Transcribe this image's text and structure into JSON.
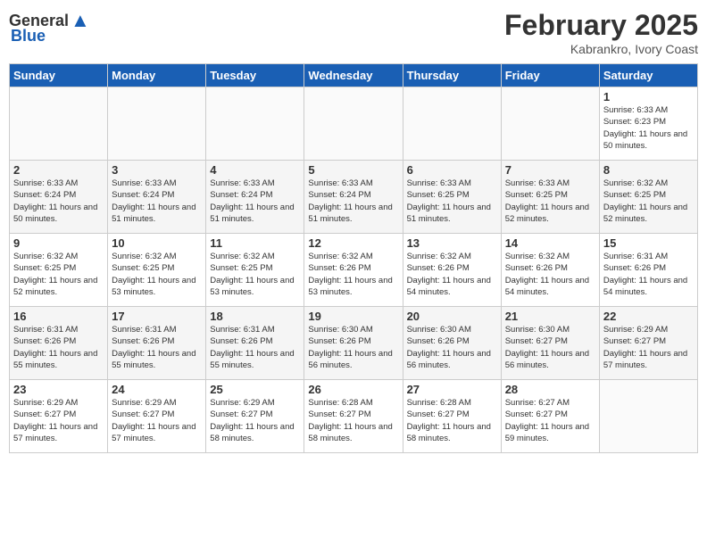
{
  "header": {
    "logo_general": "General",
    "logo_blue": "Blue",
    "main_title": "February 2025",
    "subtitle": "Kabrankro, Ivory Coast"
  },
  "days_of_week": [
    "Sunday",
    "Monday",
    "Tuesday",
    "Wednesday",
    "Thursday",
    "Friday",
    "Saturday"
  ],
  "weeks": [
    [
      {
        "day": "",
        "content": ""
      },
      {
        "day": "",
        "content": ""
      },
      {
        "day": "",
        "content": ""
      },
      {
        "day": "",
        "content": ""
      },
      {
        "day": "",
        "content": ""
      },
      {
        "day": "",
        "content": ""
      },
      {
        "day": "1",
        "content": "Sunrise: 6:33 AM\nSunset: 6:23 PM\nDaylight: 11 hours and 50 minutes."
      }
    ],
    [
      {
        "day": "2",
        "content": "Sunrise: 6:33 AM\nSunset: 6:24 PM\nDaylight: 11 hours and 50 minutes."
      },
      {
        "day": "3",
        "content": "Sunrise: 6:33 AM\nSunset: 6:24 PM\nDaylight: 11 hours and 51 minutes."
      },
      {
        "day": "4",
        "content": "Sunrise: 6:33 AM\nSunset: 6:24 PM\nDaylight: 11 hours and 51 minutes."
      },
      {
        "day": "5",
        "content": "Sunrise: 6:33 AM\nSunset: 6:24 PM\nDaylight: 11 hours and 51 minutes."
      },
      {
        "day": "6",
        "content": "Sunrise: 6:33 AM\nSunset: 6:25 PM\nDaylight: 11 hours and 51 minutes."
      },
      {
        "day": "7",
        "content": "Sunrise: 6:33 AM\nSunset: 6:25 PM\nDaylight: 11 hours and 52 minutes."
      },
      {
        "day": "8",
        "content": "Sunrise: 6:32 AM\nSunset: 6:25 PM\nDaylight: 11 hours and 52 minutes."
      }
    ],
    [
      {
        "day": "9",
        "content": "Sunrise: 6:32 AM\nSunset: 6:25 PM\nDaylight: 11 hours and 52 minutes."
      },
      {
        "day": "10",
        "content": "Sunrise: 6:32 AM\nSunset: 6:25 PM\nDaylight: 11 hours and 53 minutes."
      },
      {
        "day": "11",
        "content": "Sunrise: 6:32 AM\nSunset: 6:25 PM\nDaylight: 11 hours and 53 minutes."
      },
      {
        "day": "12",
        "content": "Sunrise: 6:32 AM\nSunset: 6:26 PM\nDaylight: 11 hours and 53 minutes."
      },
      {
        "day": "13",
        "content": "Sunrise: 6:32 AM\nSunset: 6:26 PM\nDaylight: 11 hours and 54 minutes."
      },
      {
        "day": "14",
        "content": "Sunrise: 6:32 AM\nSunset: 6:26 PM\nDaylight: 11 hours and 54 minutes."
      },
      {
        "day": "15",
        "content": "Sunrise: 6:31 AM\nSunset: 6:26 PM\nDaylight: 11 hours and 54 minutes."
      }
    ],
    [
      {
        "day": "16",
        "content": "Sunrise: 6:31 AM\nSunset: 6:26 PM\nDaylight: 11 hours and 55 minutes."
      },
      {
        "day": "17",
        "content": "Sunrise: 6:31 AM\nSunset: 6:26 PM\nDaylight: 11 hours and 55 minutes."
      },
      {
        "day": "18",
        "content": "Sunrise: 6:31 AM\nSunset: 6:26 PM\nDaylight: 11 hours and 55 minutes."
      },
      {
        "day": "19",
        "content": "Sunrise: 6:30 AM\nSunset: 6:26 PM\nDaylight: 11 hours and 56 minutes."
      },
      {
        "day": "20",
        "content": "Sunrise: 6:30 AM\nSunset: 6:26 PM\nDaylight: 11 hours and 56 minutes."
      },
      {
        "day": "21",
        "content": "Sunrise: 6:30 AM\nSunset: 6:27 PM\nDaylight: 11 hours and 56 minutes."
      },
      {
        "day": "22",
        "content": "Sunrise: 6:29 AM\nSunset: 6:27 PM\nDaylight: 11 hours and 57 minutes."
      }
    ],
    [
      {
        "day": "23",
        "content": "Sunrise: 6:29 AM\nSunset: 6:27 PM\nDaylight: 11 hours and 57 minutes."
      },
      {
        "day": "24",
        "content": "Sunrise: 6:29 AM\nSunset: 6:27 PM\nDaylight: 11 hours and 57 minutes."
      },
      {
        "day": "25",
        "content": "Sunrise: 6:29 AM\nSunset: 6:27 PM\nDaylight: 11 hours and 58 minutes."
      },
      {
        "day": "26",
        "content": "Sunrise: 6:28 AM\nSunset: 6:27 PM\nDaylight: 11 hours and 58 minutes."
      },
      {
        "day": "27",
        "content": "Sunrise: 6:28 AM\nSunset: 6:27 PM\nDaylight: 11 hours and 58 minutes."
      },
      {
        "day": "28",
        "content": "Sunrise: 6:27 AM\nSunset: 6:27 PM\nDaylight: 11 hours and 59 minutes."
      },
      {
        "day": "",
        "content": ""
      }
    ]
  ]
}
